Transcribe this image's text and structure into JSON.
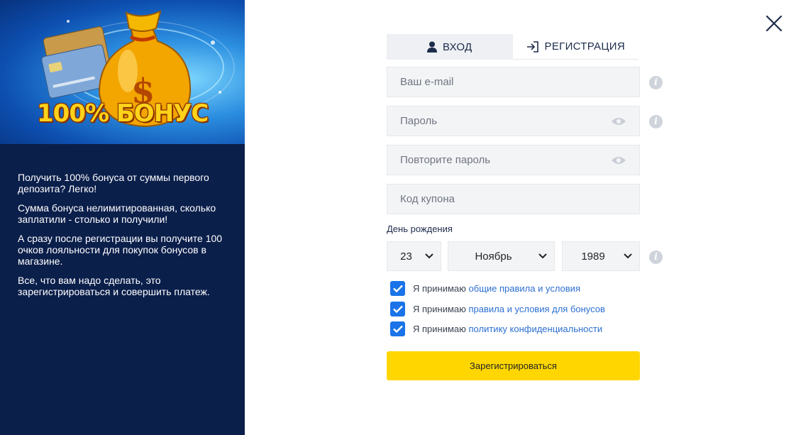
{
  "promo": {
    "banner_text": "100% БОНУС",
    "paragraphs": [
      "Получить 100% бонуса от суммы первого депозита? Легко!",
      "Сумма бонуса нелимитированная, сколько заплатили - столько и получили!",
      "А сразу после регистрации вы получите 100 очков лояльности для покупок бонусов в магазине.",
      "Все, что вам надо сделать, это зарегистрироваться и совершить платеж."
    ]
  },
  "tabs": {
    "login": {
      "label": "ВХОД",
      "icon": "user-icon"
    },
    "register": {
      "label": "РЕГИСТРАЦИЯ",
      "icon": "sign-in-icon"
    }
  },
  "form": {
    "email_placeholder": "Ваш e-mail",
    "password_placeholder": "Пароль",
    "repeat_password_placeholder": "Повторите пароль",
    "coupon_placeholder": "Код купона",
    "birthday_label": "День рождения",
    "day": "23",
    "month": "Ноябрь",
    "year": "1989",
    "checks": [
      {
        "prefix": "Я принимаю",
        "link": "общие правила и условия",
        "checked": true
      },
      {
        "prefix": "Я принимаю",
        "link": "правила и условия для бонусов",
        "checked": true
      },
      {
        "prefix": "Я принимаю",
        "link": "политику конфиденциальности",
        "checked": true
      }
    ],
    "submit_label": "Зарегистрироваться"
  },
  "colors": {
    "panel": "#0b1f4b",
    "accent": "#ffd600",
    "checkbox": "#1a73e8",
    "link": "#2c6fd1"
  }
}
